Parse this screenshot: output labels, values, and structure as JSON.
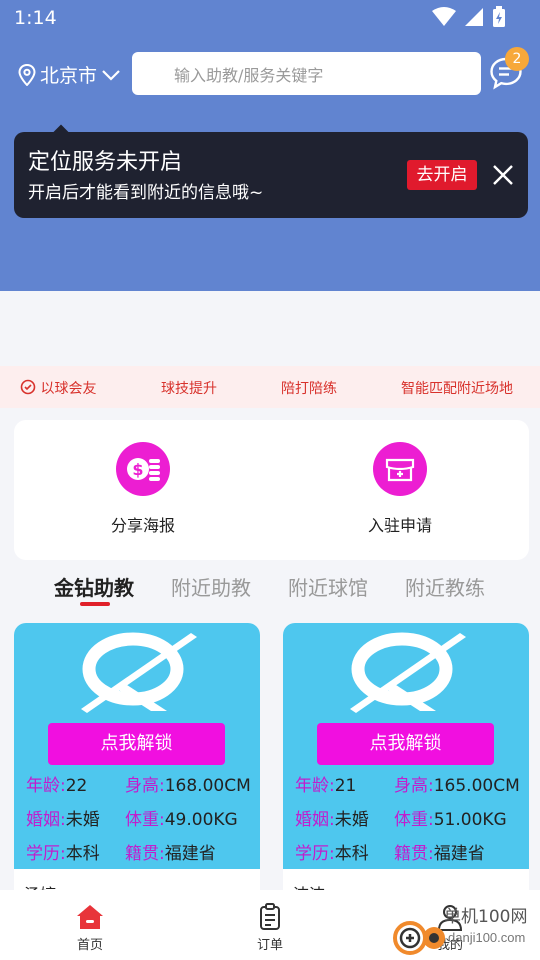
{
  "status": {
    "time": "1:14"
  },
  "location": {
    "city": "北京市"
  },
  "search": {
    "placeholder": "输入助教/服务关键字"
  },
  "messages": {
    "badge": "2"
  },
  "toast": {
    "title": "定位服务未开启",
    "subtitle": "开启后才能看到附近的信息哦~",
    "action": "去开启"
  },
  "tags": [
    "以球会友",
    "球技提升",
    "陪打陪练",
    "智能匹配附近场地"
  ],
  "features": [
    {
      "label": "分享海报",
      "icon": "dollar-coins-icon"
    },
    {
      "label": "入驻申请",
      "icon": "store-add-icon"
    }
  ],
  "tabs": [
    "金钻助教",
    "附近助教",
    "附近球馆",
    "附近教练"
  ],
  "coaches": [
    {
      "unlock": "点我解锁",
      "age_label": "年龄:",
      "age": "22",
      "height_label": "身高:",
      "height": "168.00CM",
      "marital_label": "婚姻:",
      "marital": "未婚",
      "weight_label": "体重:",
      "weight": "49.00KG",
      "education_label": "学历:",
      "education": "本科",
      "origin_label": "籍贯:",
      "origin": "福建省",
      "name": "汤婷"
    },
    {
      "unlock": "点我解锁",
      "age_label": "年龄:",
      "age": "21",
      "height_label": "身高:",
      "height": "165.00CM",
      "marital_label": "婚姻:",
      "marital": "未婚",
      "weight_label": "体重:",
      "weight": "51.00KG",
      "education_label": "学历:",
      "education": "本科",
      "origin_label": "籍贯:",
      "origin": "福建省",
      "name": "洁洁"
    }
  ],
  "nav": [
    {
      "label": "首页",
      "icon": "home-icon"
    },
    {
      "label": "订单",
      "icon": "order-clipboard-icon"
    },
    {
      "label": "我的",
      "icon": "user-icon"
    }
  ],
  "watermark": {
    "name": "单机100网",
    "url": "danji100.com"
  },
  "colors": {
    "header_blue": "#6184d0",
    "accent_red": "#e01a2d",
    "magenta": "#ec1ed2",
    "card_cyan": "#4ec7ee",
    "badge_orange": "#f7a83a"
  }
}
